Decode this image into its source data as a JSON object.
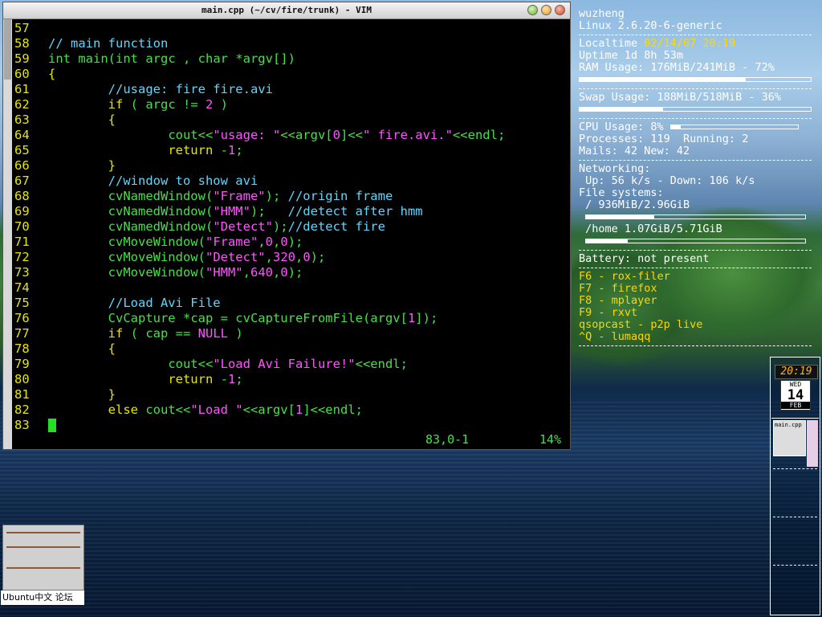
{
  "window": {
    "title": "main.cpp (~/cv/fire/trunk) - VIM"
  },
  "editor": {
    "lines": [
      {
        "n": "57"
      },
      {
        "n": "58",
        "t": "// main function"
      },
      {
        "n": "59",
        "a": "int",
        "b": " main(",
        "c": "int",
        "d": " argc , ",
        "e": "char",
        "f": " *argv[])"
      },
      {
        "n": "60",
        "t": "{"
      },
      {
        "n": "61",
        "t": "//usage: fire fire.avi"
      },
      {
        "n": "62",
        "a": "if",
        "b": " ( argc != ",
        "c": "2",
        "d": " )"
      },
      {
        "n": "63",
        "t": "{"
      },
      {
        "n": "64",
        "a": "cout<<",
        "b": "\"usage: \"",
        "c": "<<argv[",
        "d": "0",
        "e": "]<<",
        "f": "\" fire.avi.\"",
        "g": "<<endl;"
      },
      {
        "n": "65",
        "a": "return",
        "b": " -",
        "c": "1",
        "d": ";"
      },
      {
        "n": "66",
        "t": "}"
      },
      {
        "n": "67",
        "t": "//window to show avi"
      },
      {
        "n": "68",
        "a": "cvNamedWindow(",
        "b": "\"Frame\"",
        "c": "); ",
        "d": "//origin frame"
      },
      {
        "n": "69",
        "a": "cvNamedWindow(",
        "b": "\"HMM\"",
        "c": ");   ",
        "d": "//detect after hmm"
      },
      {
        "n": "70",
        "a": "cvNamedWindow(",
        "b": "\"Detect\"",
        "c": ");",
        "d": "//detect fire"
      },
      {
        "n": "71",
        "a": "cvMoveWindow(",
        "b": "\"Frame\"",
        "c": ",",
        "d": "0",
        "e": ",",
        "f": "0",
        "g": ");"
      },
      {
        "n": "72",
        "a": "cvMoveWindow(",
        "b": "\"Detect\"",
        "c": ",",
        "d": "320",
        "e": ",",
        "f": "0",
        "g": ");"
      },
      {
        "n": "73",
        "a": "cvMoveWindow(",
        "b": "\"HMM\"",
        "c": ",",
        "d": "640",
        "e": ",",
        "f": "0",
        "g": ");"
      },
      {
        "n": "74"
      },
      {
        "n": "75",
        "t": "//Load Avi File"
      },
      {
        "n": "76",
        "a": "CvCapture",
        "b": " *cap = cvCaptureFromFile(argv[",
        "c": "1",
        "d": "]);"
      },
      {
        "n": "77",
        "a": "if",
        "b": " ( cap == ",
        "c": "NULL",
        "d": " )"
      },
      {
        "n": "78",
        "t": "{"
      },
      {
        "n": "79",
        "a": "cout<<",
        "b": "\"Load Avi Failure!\"",
        "c": "<<endl;"
      },
      {
        "n": "80",
        "a": "return",
        "b": " -",
        "c": "1",
        "d": ";"
      },
      {
        "n": "81",
        "t": "}"
      },
      {
        "n": "82",
        "a": "else",
        "b": " cout<<",
        "c": "\"Load \"",
        "d": "<<argv[",
        "e": "1",
        "f": "]<<endl;"
      },
      {
        "n": "83"
      }
    ],
    "status_position": "83,0-1",
    "status_percent": "14%"
  },
  "conky": {
    "user": "wuzheng",
    "kernel": "Linux 2.6.20-6-generic",
    "localtime_label": "Localtime ",
    "localtime_value": "02/14/07 20:19",
    "uptime": "Uptime 1d 8h 53m",
    "ram": "RAM Usage: 176MiB/241MiB - 72%",
    "ram_fraction": 0.72,
    "swap": "Swap Usage: 188MiB/518MiB - 36%",
    "swap_fraction": 0.36,
    "cpu": "CPU Usage: 8%",
    "cpu_fraction": 0.08,
    "processes": "Processes: 119  Running: 2",
    "mails": "Mails: 42 New: 42",
    "networking": "Networking:",
    "net_rates": " Up: 56 k/s - Down: 106 k/s",
    "filesystems": "File systems:",
    "fs_root": " / 936MiB/2.96GiB",
    "fs_root_fraction": 0.31,
    "fs_home": " /home 1.07GiB/5.71GiB",
    "fs_home_fraction": 0.19,
    "battery": "Battery: not present",
    "shortcuts": [
      "F6 - rox-filer",
      "F7 - firefox",
      "F8 - mplayer",
      "F9 - rxvt",
      "qsopcast - p2p live",
      "^Q - lumaqq"
    ]
  },
  "dock": {
    "clock": "20:19",
    "cal_dow": "WED",
    "cal_day": "14",
    "cal_month": "FEB",
    "pager_window": "main.cpp"
  },
  "taskbar": {
    "label": "Ubuntu中文 论坛"
  },
  "colors": {
    "line_number": "#e6e600",
    "comment": "#5fd7ff",
    "string": "#ff55ff",
    "text": "#48e048"
  }
}
